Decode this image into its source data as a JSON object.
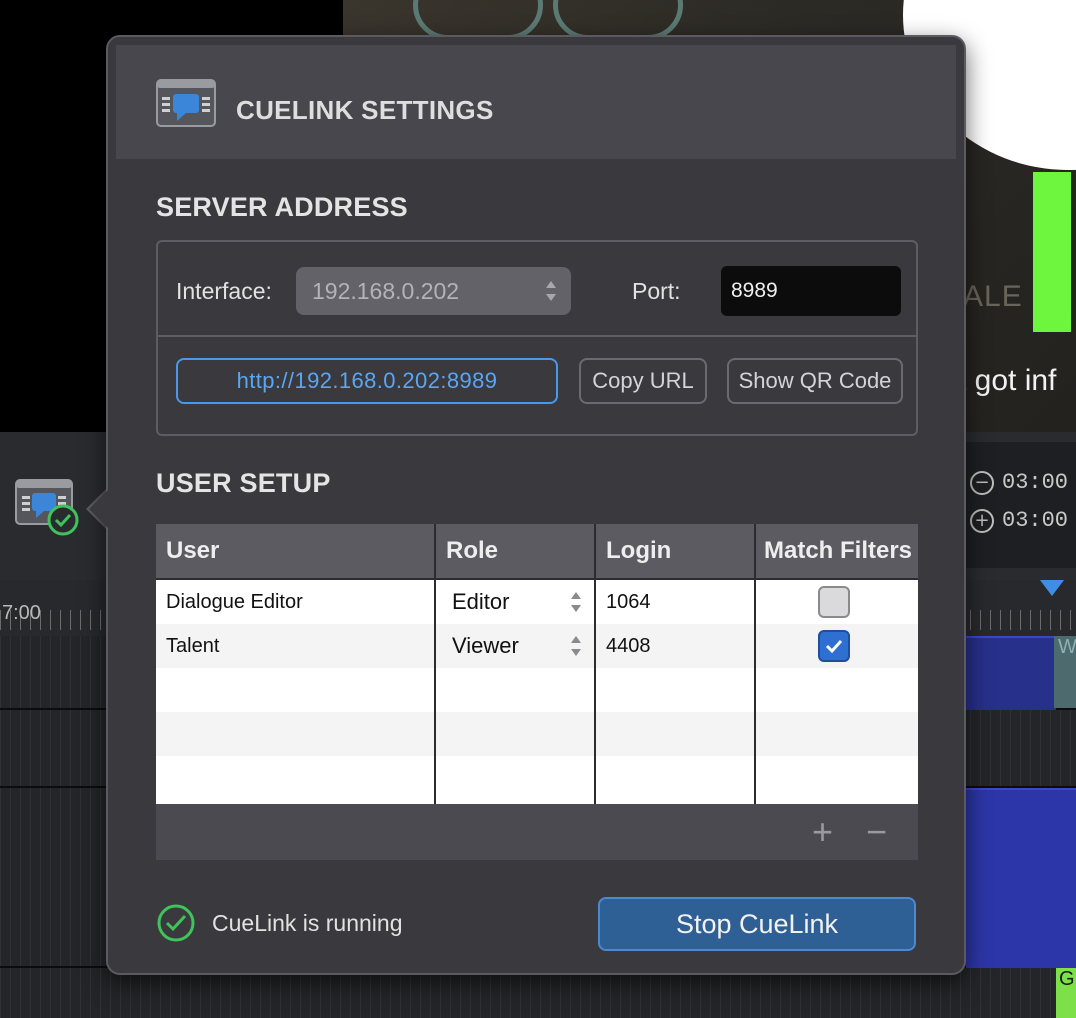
{
  "background": {
    "subtitle_text": "st got inf",
    "watermark_text": "ALE",
    "timecode_rows": [
      {
        "icon": "minus-circle-icon",
        "value": "03:00"
      },
      {
        "icon": "plus-circle-icon",
        "value": "03:00"
      }
    ],
    "ruler_label": "7:00",
    "clip_labels": [
      "G",
      "W",
      "G"
    ]
  },
  "dialog": {
    "title": "CUELINK SETTINGS",
    "icon": "cuelink-icon",
    "server_address": {
      "heading": "SERVER ADDRESS",
      "interface_label": "Interface:",
      "interface_value": "192.168.0.202",
      "port_label": "Port:",
      "port_value": "8989",
      "url": "http://192.168.0.202:8989",
      "copy_url_label": "Copy URL",
      "show_qr_label": "Show QR Code"
    },
    "user_setup": {
      "heading": "USER SETUP",
      "columns": [
        "User",
        "Role",
        "Login",
        "Match Filters"
      ],
      "rows": [
        {
          "user": "Dialogue Editor",
          "role": "Editor",
          "login": "1064",
          "match_filters": false
        },
        {
          "user": "Talent",
          "role": "Viewer",
          "login": "4408",
          "match_filters": true
        }
      ],
      "add_label": "+",
      "remove_label": "−"
    },
    "status_text": "CueLink is running",
    "stop_button_label": "Stop CueLink"
  },
  "colors": {
    "accent_blue": "#4c97e8",
    "status_green": "#3fc35a",
    "stop_button": "#2e5f95"
  }
}
